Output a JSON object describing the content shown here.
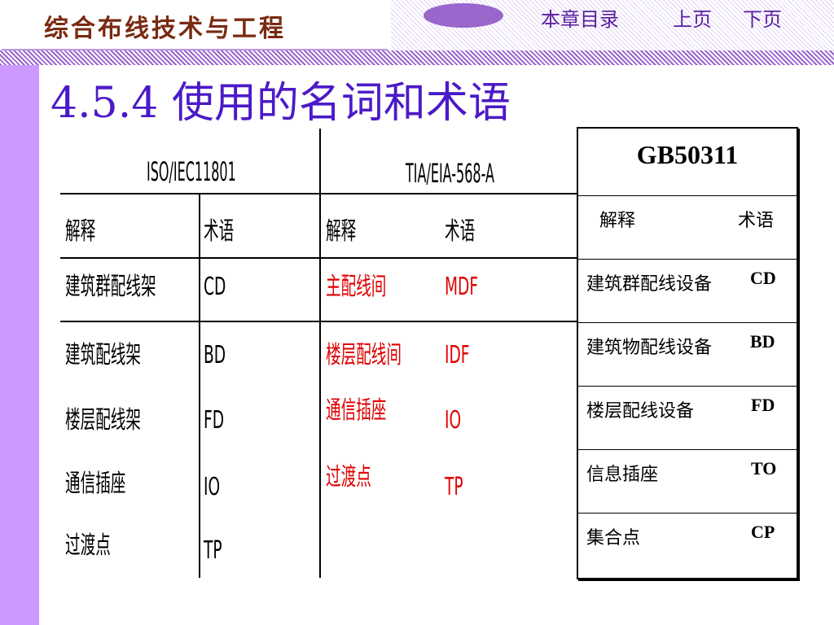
{
  "header": {
    "logo_text": "综合布线技术与工程",
    "nav": {
      "toc": "本章目录",
      "prev": "上页",
      "next": "下页"
    }
  },
  "title": "4.5.4 使用的名词和术语",
  "iso_table": {
    "headers": {
      "iso": "ISO/IEC11801",
      "tia": "TIA/EIA-568-A"
    },
    "subheaders": {
      "iso_explain": "解释",
      "iso_term": "术语",
      "tia_explain": "解释",
      "tia_term": "术语"
    },
    "rows": [
      {
        "iso_explain": "建筑群配线架",
        "iso_term": "CD",
        "tia_explain": "主配线间",
        "tia_term": "MDF"
      },
      {
        "iso_explain": "建筑配线架",
        "iso_term": "BD",
        "tia_explain": "楼层配线间",
        "tia_term": "IDF"
      },
      {
        "iso_explain": "楼层配线架",
        "iso_term": "FD",
        "tia_explain": "通信插座",
        "tia_term": "IO"
      },
      {
        "iso_explain": "通信插座",
        "iso_term": "IO",
        "tia_explain": "过渡点",
        "tia_term": "TP"
      },
      {
        "iso_explain": "过渡点",
        "iso_term": "TP",
        "tia_explain": "",
        "tia_term": ""
      }
    ]
  },
  "gb_table": {
    "title": "GB50311",
    "explain": "解释",
    "term": "术语",
    "rows": [
      {
        "text": "建筑群配线设备",
        "code": "CD"
      },
      {
        "text": "建筑物配线设备",
        "code": "BD"
      },
      {
        "text": "楼层配线设备",
        "code": "FD"
      },
      {
        "text": "信息插座",
        "code": "TO"
      },
      {
        "text": "集合点",
        "code": "CP"
      }
    ]
  },
  "colors": {
    "title": "#4b1ac7",
    "side_bar": "#cc99ff",
    "red_text": "#e00000",
    "logo": "#7a2a12"
  }
}
